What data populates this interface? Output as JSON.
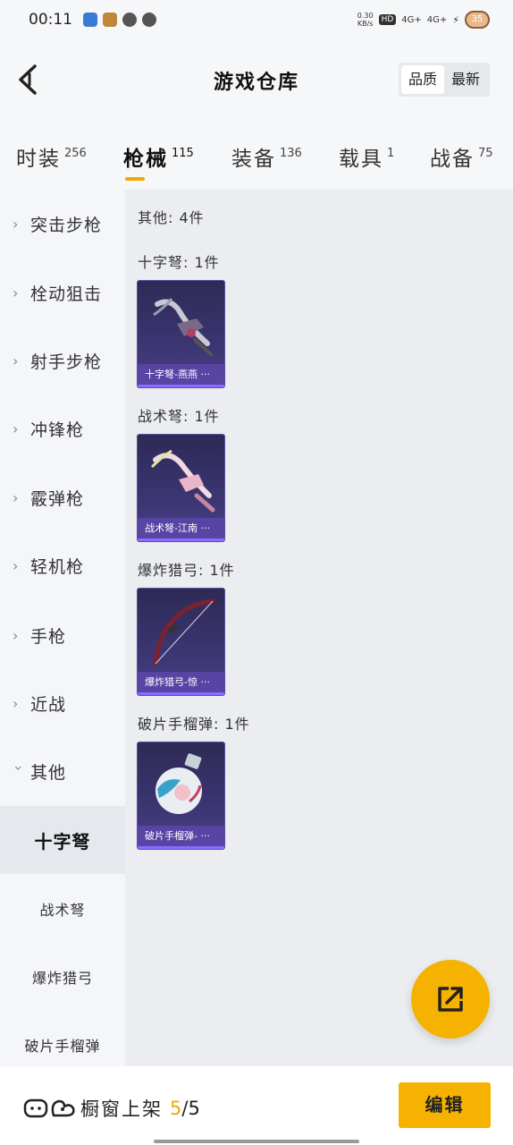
{
  "status_bar": {
    "time": "00:11",
    "net_speed_value": "0.30",
    "net_speed_unit": "KB/s",
    "hd": "HD",
    "signal1": "4G+",
    "signal2": "4G+",
    "battery": "35"
  },
  "header": {
    "title": "游戏仓库",
    "sort_quality": "品质",
    "sort_newest": "最新"
  },
  "tabs": [
    {
      "label": "时装",
      "count": "256"
    },
    {
      "label": "枪械",
      "count": "115",
      "active": true
    },
    {
      "label": "装备",
      "count": "136"
    },
    {
      "label": "载具",
      "count": "1"
    },
    {
      "label": "战备",
      "count": "75"
    }
  ],
  "sidebar": {
    "categories": [
      {
        "label": "突击步枪"
      },
      {
        "label": "栓动狙击"
      },
      {
        "label": "射手步枪"
      },
      {
        "label": "冲锋枪"
      },
      {
        "label": "霰弹枪"
      },
      {
        "label": "轻机枪"
      },
      {
        "label": "手枪"
      },
      {
        "label": "近战"
      },
      {
        "label": "其他",
        "expanded": true
      }
    ],
    "subcategories": [
      {
        "label": "十字弩",
        "active": true
      },
      {
        "label": "战术弩"
      },
      {
        "label": "爆炸猎弓"
      },
      {
        "label": "破片手榴弹"
      }
    ]
  },
  "content": {
    "summary": "其他: 4件",
    "sections": [
      {
        "title": "十字弩: 1件",
        "item_name": "十字弩-燕燕 ···",
        "icon": "crossbow-icon"
      },
      {
        "title": "战术弩: 1件",
        "item_name": "战术弩-江南 ···",
        "icon": "tactical-crossbow-icon"
      },
      {
        "title": "爆炸猎弓: 1件",
        "item_name": "爆炸猎弓-惊 ···",
        "icon": "bow-icon"
      },
      {
        "title": "破片手榴弹: 1件",
        "item_name": "破片手榴弹- ···",
        "icon": "grenade-icon"
      }
    ]
  },
  "bottom_bar": {
    "shelf_label": "橱窗上架",
    "shelf_current": "5",
    "shelf_total": "/5",
    "edit_label": "编辑"
  },
  "colors": {
    "accent": "#f6b200",
    "card_bg": "#3a3470"
  }
}
